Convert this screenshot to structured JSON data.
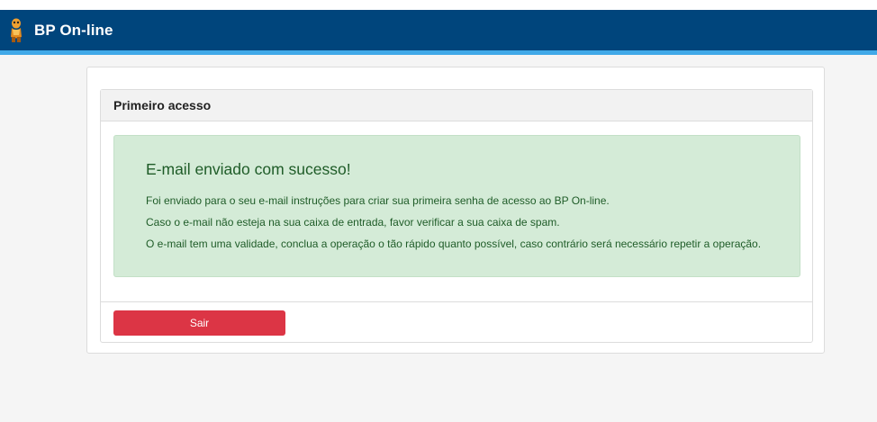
{
  "app": {
    "title": "BP On-line",
    "logo_icon": "mascot-logo-icon"
  },
  "colors": {
    "navbar": "#00457c",
    "accent": "#41a9e8",
    "success_bg": "#d4ebd7",
    "success_text": "#1f5c28",
    "danger": "#dc3545"
  },
  "panel": {
    "title": "Primeiro acesso"
  },
  "alert": {
    "title": "E-mail enviado com sucesso!",
    "lines": [
      "Foi enviado para o seu e-mail instruções para criar sua primeira senha de acesso ao BP On-line.",
      "Caso o e-mail não esteja na sua caixa de entrada, favor verificar a sua caixa de spam.",
      "O e-mail tem uma validade, conclua a operação o tão rápido quanto possível, caso contrário será necessário repetir a operação."
    ]
  },
  "actions": {
    "exit_label": "Sair"
  }
}
